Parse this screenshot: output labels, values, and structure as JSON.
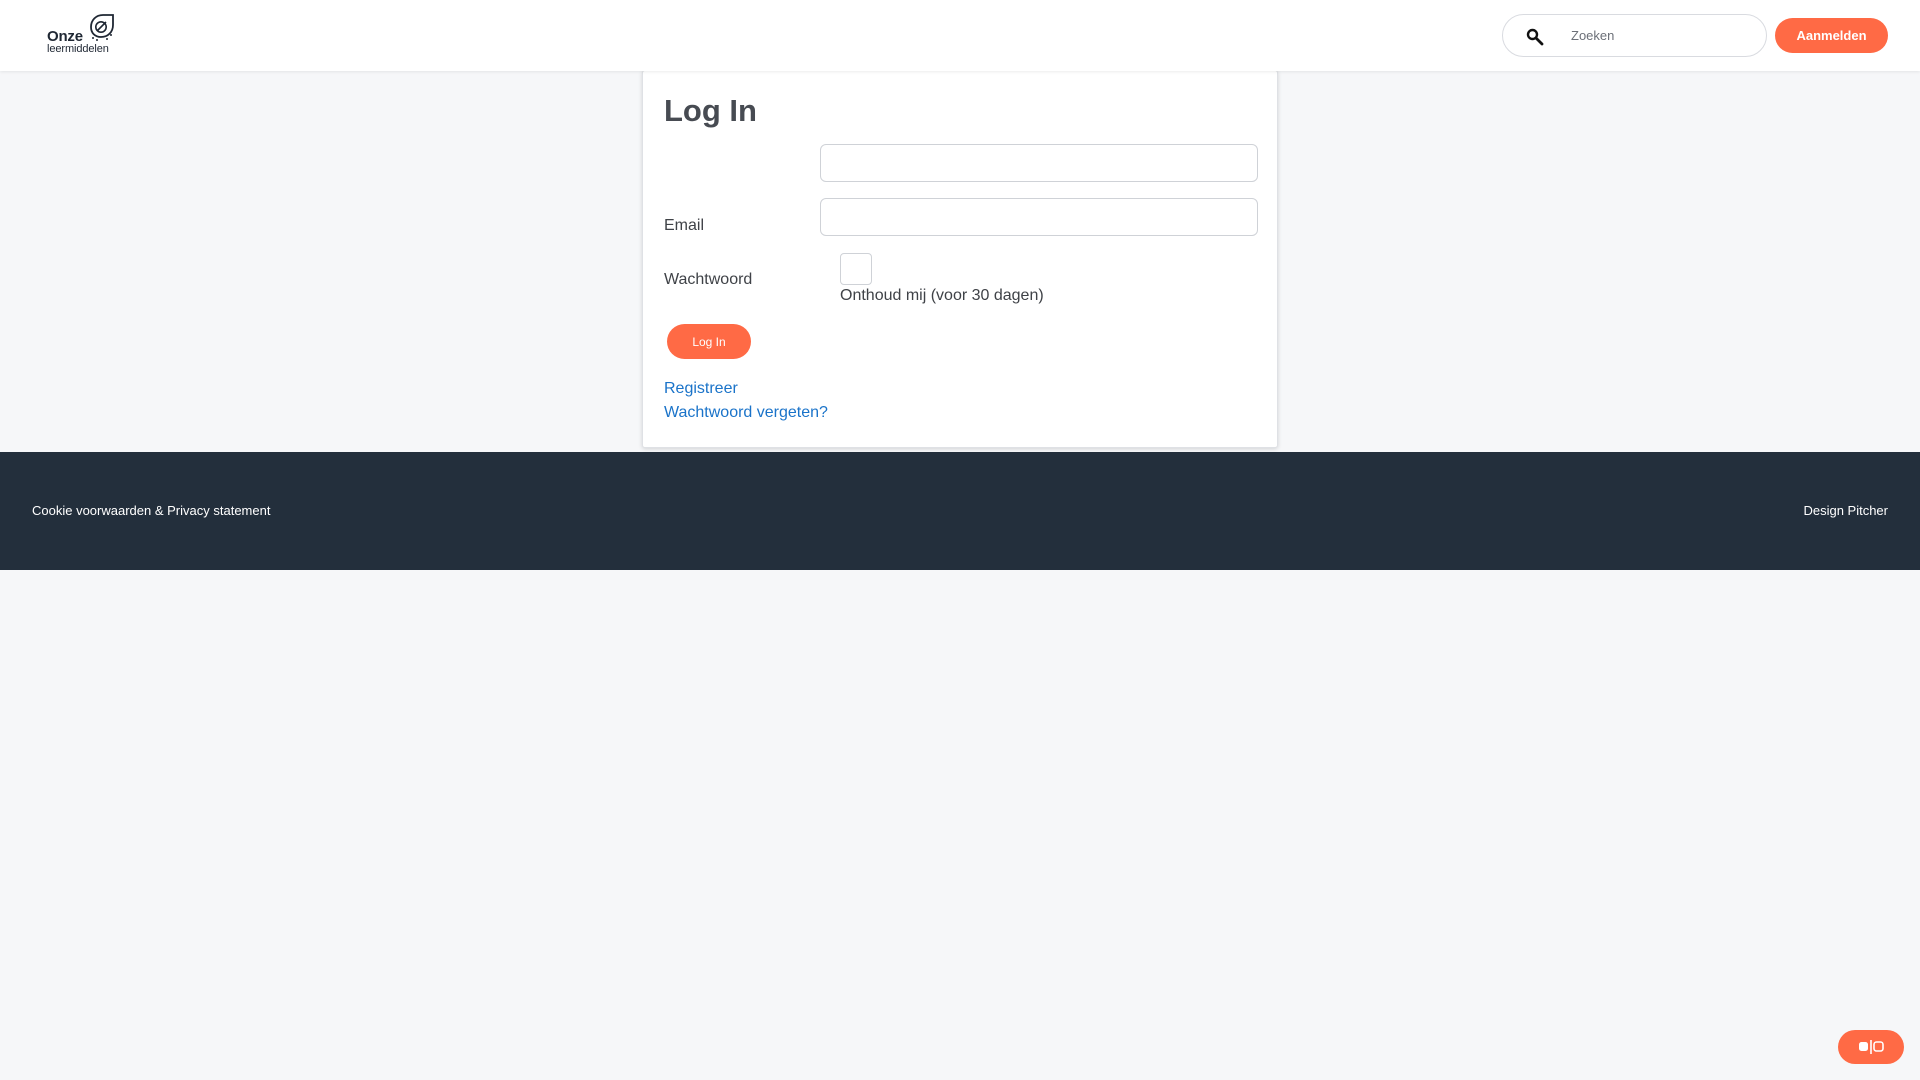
{
  "header": {
    "logo": {
      "line1": "Onze",
      "line2": "leermiddelen"
    },
    "search": {
      "placeholder": "Zoeken",
      "icon": "search-icon"
    },
    "signup_label": "Aanmelden"
  },
  "login": {
    "title": "Log In",
    "email_label": "Email",
    "email_value": "",
    "password_label": "Wachtwoord",
    "password_value": "",
    "remember_label": "Onthoud mij (voor 30 dagen)",
    "remember_checked": false,
    "submit_label": "Log In",
    "register_link": "Registreer",
    "forgot_link": "Wachtwoord vergeten?"
  },
  "footer": {
    "left_link": "Cookie voorwaarden & Privacy statement",
    "right_link": "Design Pitcher"
  },
  "colors": {
    "accent": "#ff6a45",
    "link": "#1a73c9",
    "footer_bg": "#232f3c",
    "page_bg": "#f6f7f9"
  }
}
